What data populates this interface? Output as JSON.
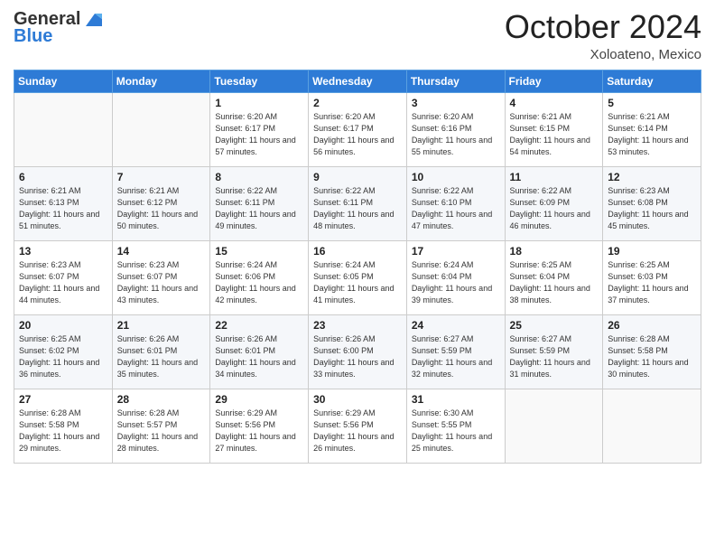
{
  "header": {
    "logo_line1": "General",
    "logo_line2": "Blue",
    "title": "October 2024",
    "location": "Xoloateno, Mexico"
  },
  "weekdays": [
    "Sunday",
    "Monday",
    "Tuesday",
    "Wednesday",
    "Thursday",
    "Friday",
    "Saturday"
  ],
  "weeks": [
    [
      {
        "day": "",
        "sunrise": "",
        "sunset": "",
        "daylight": ""
      },
      {
        "day": "",
        "sunrise": "",
        "sunset": "",
        "daylight": ""
      },
      {
        "day": "1",
        "sunrise": "Sunrise: 6:20 AM",
        "sunset": "Sunset: 6:17 PM",
        "daylight": "Daylight: 11 hours and 57 minutes."
      },
      {
        "day": "2",
        "sunrise": "Sunrise: 6:20 AM",
        "sunset": "Sunset: 6:17 PM",
        "daylight": "Daylight: 11 hours and 56 minutes."
      },
      {
        "day": "3",
        "sunrise": "Sunrise: 6:20 AM",
        "sunset": "Sunset: 6:16 PM",
        "daylight": "Daylight: 11 hours and 55 minutes."
      },
      {
        "day": "4",
        "sunrise": "Sunrise: 6:21 AM",
        "sunset": "Sunset: 6:15 PM",
        "daylight": "Daylight: 11 hours and 54 minutes."
      },
      {
        "day": "5",
        "sunrise": "Sunrise: 6:21 AM",
        "sunset": "Sunset: 6:14 PM",
        "daylight": "Daylight: 11 hours and 53 minutes."
      }
    ],
    [
      {
        "day": "6",
        "sunrise": "Sunrise: 6:21 AM",
        "sunset": "Sunset: 6:13 PM",
        "daylight": "Daylight: 11 hours and 51 minutes."
      },
      {
        "day": "7",
        "sunrise": "Sunrise: 6:21 AM",
        "sunset": "Sunset: 6:12 PM",
        "daylight": "Daylight: 11 hours and 50 minutes."
      },
      {
        "day": "8",
        "sunrise": "Sunrise: 6:22 AM",
        "sunset": "Sunset: 6:11 PM",
        "daylight": "Daylight: 11 hours and 49 minutes."
      },
      {
        "day": "9",
        "sunrise": "Sunrise: 6:22 AM",
        "sunset": "Sunset: 6:11 PM",
        "daylight": "Daylight: 11 hours and 48 minutes."
      },
      {
        "day": "10",
        "sunrise": "Sunrise: 6:22 AM",
        "sunset": "Sunset: 6:10 PM",
        "daylight": "Daylight: 11 hours and 47 minutes."
      },
      {
        "day": "11",
        "sunrise": "Sunrise: 6:22 AM",
        "sunset": "Sunset: 6:09 PM",
        "daylight": "Daylight: 11 hours and 46 minutes."
      },
      {
        "day": "12",
        "sunrise": "Sunrise: 6:23 AM",
        "sunset": "Sunset: 6:08 PM",
        "daylight": "Daylight: 11 hours and 45 minutes."
      }
    ],
    [
      {
        "day": "13",
        "sunrise": "Sunrise: 6:23 AM",
        "sunset": "Sunset: 6:07 PM",
        "daylight": "Daylight: 11 hours and 44 minutes."
      },
      {
        "day": "14",
        "sunrise": "Sunrise: 6:23 AM",
        "sunset": "Sunset: 6:07 PM",
        "daylight": "Daylight: 11 hours and 43 minutes."
      },
      {
        "day": "15",
        "sunrise": "Sunrise: 6:24 AM",
        "sunset": "Sunset: 6:06 PM",
        "daylight": "Daylight: 11 hours and 42 minutes."
      },
      {
        "day": "16",
        "sunrise": "Sunrise: 6:24 AM",
        "sunset": "Sunset: 6:05 PM",
        "daylight": "Daylight: 11 hours and 41 minutes."
      },
      {
        "day": "17",
        "sunrise": "Sunrise: 6:24 AM",
        "sunset": "Sunset: 6:04 PM",
        "daylight": "Daylight: 11 hours and 39 minutes."
      },
      {
        "day": "18",
        "sunrise": "Sunrise: 6:25 AM",
        "sunset": "Sunset: 6:04 PM",
        "daylight": "Daylight: 11 hours and 38 minutes."
      },
      {
        "day": "19",
        "sunrise": "Sunrise: 6:25 AM",
        "sunset": "Sunset: 6:03 PM",
        "daylight": "Daylight: 11 hours and 37 minutes."
      }
    ],
    [
      {
        "day": "20",
        "sunrise": "Sunrise: 6:25 AM",
        "sunset": "Sunset: 6:02 PM",
        "daylight": "Daylight: 11 hours and 36 minutes."
      },
      {
        "day": "21",
        "sunrise": "Sunrise: 6:26 AM",
        "sunset": "Sunset: 6:01 PM",
        "daylight": "Daylight: 11 hours and 35 minutes."
      },
      {
        "day": "22",
        "sunrise": "Sunrise: 6:26 AM",
        "sunset": "Sunset: 6:01 PM",
        "daylight": "Daylight: 11 hours and 34 minutes."
      },
      {
        "day": "23",
        "sunrise": "Sunrise: 6:26 AM",
        "sunset": "Sunset: 6:00 PM",
        "daylight": "Daylight: 11 hours and 33 minutes."
      },
      {
        "day": "24",
        "sunrise": "Sunrise: 6:27 AM",
        "sunset": "Sunset: 5:59 PM",
        "daylight": "Daylight: 11 hours and 32 minutes."
      },
      {
        "day": "25",
        "sunrise": "Sunrise: 6:27 AM",
        "sunset": "Sunset: 5:59 PM",
        "daylight": "Daylight: 11 hours and 31 minutes."
      },
      {
        "day": "26",
        "sunrise": "Sunrise: 6:28 AM",
        "sunset": "Sunset: 5:58 PM",
        "daylight": "Daylight: 11 hours and 30 minutes."
      }
    ],
    [
      {
        "day": "27",
        "sunrise": "Sunrise: 6:28 AM",
        "sunset": "Sunset: 5:58 PM",
        "daylight": "Daylight: 11 hours and 29 minutes."
      },
      {
        "day": "28",
        "sunrise": "Sunrise: 6:28 AM",
        "sunset": "Sunset: 5:57 PM",
        "daylight": "Daylight: 11 hours and 28 minutes."
      },
      {
        "day": "29",
        "sunrise": "Sunrise: 6:29 AM",
        "sunset": "Sunset: 5:56 PM",
        "daylight": "Daylight: 11 hours and 27 minutes."
      },
      {
        "day": "30",
        "sunrise": "Sunrise: 6:29 AM",
        "sunset": "Sunset: 5:56 PM",
        "daylight": "Daylight: 11 hours and 26 minutes."
      },
      {
        "day": "31",
        "sunrise": "Sunrise: 6:30 AM",
        "sunset": "Sunset: 5:55 PM",
        "daylight": "Daylight: 11 hours and 25 minutes."
      },
      {
        "day": "",
        "sunrise": "",
        "sunset": "",
        "daylight": ""
      },
      {
        "day": "",
        "sunrise": "",
        "sunset": "",
        "daylight": ""
      }
    ]
  ]
}
